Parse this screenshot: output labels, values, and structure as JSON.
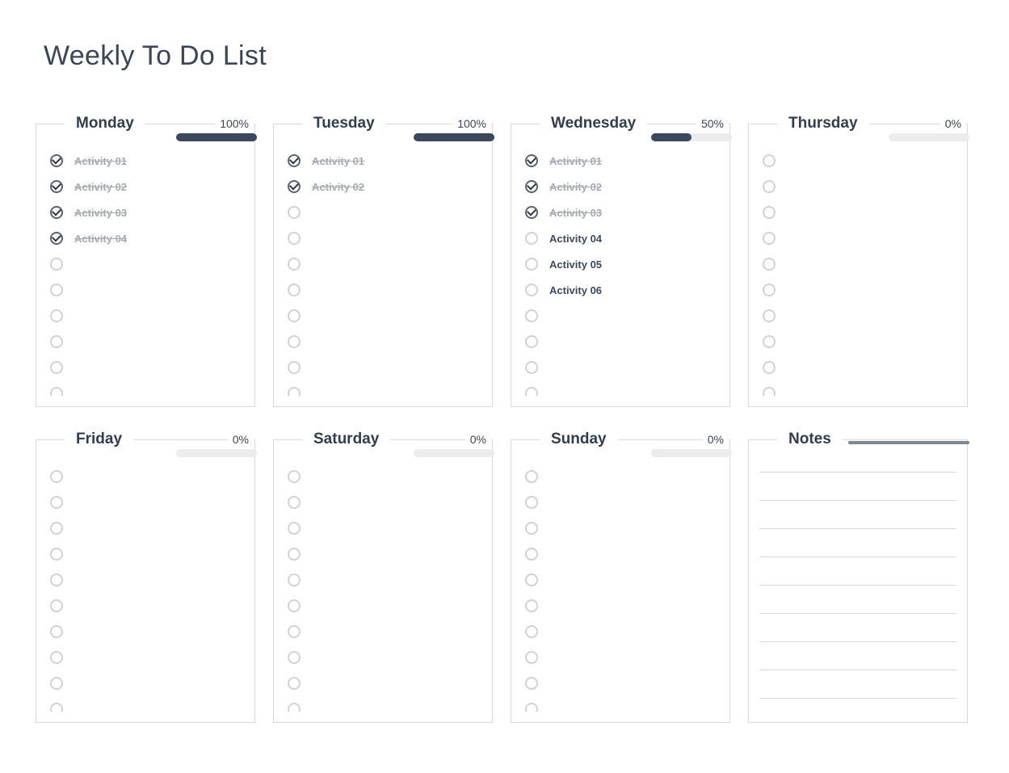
{
  "title": "Weekly To Do List",
  "days": [
    {
      "name": "Monday",
      "percent": "100%",
      "progress": 100,
      "tasks": [
        {
          "label": "Activity 01",
          "done": true
        },
        {
          "label": "Activity 02",
          "done": true
        },
        {
          "label": "Activity 03",
          "done": true
        },
        {
          "label": "Activity 04",
          "done": true
        },
        {
          "label": "",
          "done": false
        },
        {
          "label": "",
          "done": false
        },
        {
          "label": "",
          "done": false
        },
        {
          "label": "",
          "done": false
        },
        {
          "label": "",
          "done": false
        },
        {
          "label": "",
          "done": false
        }
      ]
    },
    {
      "name": "Tuesday",
      "percent": "100%",
      "progress": 100,
      "tasks": [
        {
          "label": "Activity 01",
          "done": true
        },
        {
          "label": "Activity 02",
          "done": true
        },
        {
          "label": "",
          "done": false
        },
        {
          "label": "",
          "done": false
        },
        {
          "label": "",
          "done": false
        },
        {
          "label": "",
          "done": false
        },
        {
          "label": "",
          "done": false
        },
        {
          "label": "",
          "done": false
        },
        {
          "label": "",
          "done": false
        },
        {
          "label": "",
          "done": false
        }
      ]
    },
    {
      "name": "Wednesday",
      "percent": "50%",
      "progress": 50,
      "tasks": [
        {
          "label": "Activity 01",
          "done": true
        },
        {
          "label": "Activity 02",
          "done": true
        },
        {
          "label": "Activity 03",
          "done": true
        },
        {
          "label": "Activity 04",
          "done": false
        },
        {
          "label": "Activity 05",
          "done": false
        },
        {
          "label": "Activity 06",
          "done": false
        },
        {
          "label": "",
          "done": false
        },
        {
          "label": "",
          "done": false
        },
        {
          "label": "",
          "done": false
        },
        {
          "label": "",
          "done": false
        }
      ]
    },
    {
      "name": "Thursday",
      "percent": "0%",
      "progress": 0,
      "tasks": [
        {
          "label": "",
          "done": false
        },
        {
          "label": "",
          "done": false
        },
        {
          "label": "",
          "done": false
        },
        {
          "label": "",
          "done": false
        },
        {
          "label": "",
          "done": false
        },
        {
          "label": "",
          "done": false
        },
        {
          "label": "",
          "done": false
        },
        {
          "label": "",
          "done": false
        },
        {
          "label": "",
          "done": false
        },
        {
          "label": "",
          "done": false
        }
      ]
    },
    {
      "name": "Friday",
      "percent": "0%",
      "progress": 0,
      "tasks": [
        {
          "label": "",
          "done": false
        },
        {
          "label": "",
          "done": false
        },
        {
          "label": "",
          "done": false
        },
        {
          "label": "",
          "done": false
        },
        {
          "label": "",
          "done": false
        },
        {
          "label": "",
          "done": false
        },
        {
          "label": "",
          "done": false
        },
        {
          "label": "",
          "done": false
        },
        {
          "label": "",
          "done": false
        },
        {
          "label": "",
          "done": false
        }
      ]
    },
    {
      "name": "Saturday",
      "percent": "0%",
      "progress": 0,
      "tasks": [
        {
          "label": "",
          "done": false
        },
        {
          "label": "",
          "done": false
        },
        {
          "label": "",
          "done": false
        },
        {
          "label": "",
          "done": false
        },
        {
          "label": "",
          "done": false
        },
        {
          "label": "",
          "done": false
        },
        {
          "label": "",
          "done": false
        },
        {
          "label": "",
          "done": false
        },
        {
          "label": "",
          "done": false
        },
        {
          "label": "",
          "done": false
        }
      ]
    },
    {
      "name": "Sunday",
      "percent": "0%",
      "progress": 0,
      "tasks": [
        {
          "label": "",
          "done": false
        },
        {
          "label": "",
          "done": false
        },
        {
          "label": "",
          "done": false
        },
        {
          "label": "",
          "done": false
        },
        {
          "label": "",
          "done": false
        },
        {
          "label": "",
          "done": false
        },
        {
          "label": "",
          "done": false
        },
        {
          "label": "",
          "done": false
        },
        {
          "label": "",
          "done": false
        },
        {
          "label": "",
          "done": false
        }
      ]
    }
  ],
  "notes": {
    "title": "Notes",
    "line_count": 8
  }
}
